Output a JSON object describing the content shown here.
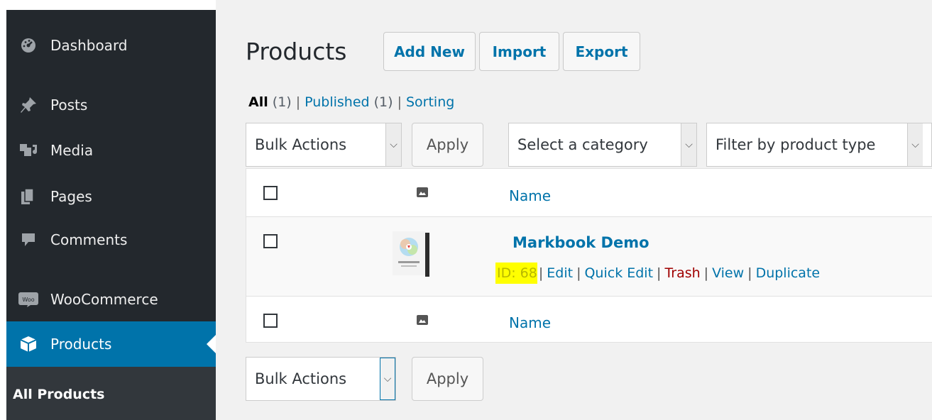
{
  "sidebar": {
    "items": [
      {
        "label": "Dashboard",
        "icon": "dashboard-icon"
      },
      {
        "label": "Posts",
        "icon": "pushpin-icon"
      },
      {
        "label": "Media",
        "icon": "media-icon"
      },
      {
        "label": "Pages",
        "icon": "pages-icon"
      },
      {
        "label": "Comments",
        "icon": "comments-icon"
      },
      {
        "label": "WooCommerce",
        "icon": "woocommerce-icon"
      },
      {
        "label": "Products",
        "icon": "products-box-icon"
      }
    ],
    "submenu": {
      "label": "All Products"
    },
    "colors": {
      "background": "#23282d",
      "active": "#0073aa"
    }
  },
  "header": {
    "title": "Products",
    "buttons": {
      "add_new": "Add New",
      "import": "Import",
      "export": "Export"
    }
  },
  "views": {
    "all": "All",
    "all_count": "(1)",
    "published": "Published",
    "published_count": "(1)",
    "sorting": "Sorting",
    "separator": "|"
  },
  "filters": {
    "bulk_actions": "Bulk Actions",
    "apply": "Apply",
    "category": "Select a category",
    "product_type": "Filter by product type"
  },
  "table": {
    "column_name": "Name",
    "rows": [
      {
        "name": "Markbook Demo",
        "id_label": "ID: 68",
        "actions": {
          "edit": "Edit",
          "quick_edit": "Quick Edit",
          "trash": "Trash",
          "view": "View",
          "duplicate": "Duplicate"
        }
      }
    ]
  },
  "bottom": {
    "bulk_actions": "Bulk Actions",
    "apply": "Apply"
  },
  "colors": {
    "link": "#0073aa",
    "trash": "#a00000",
    "highlight": "#ffff00"
  }
}
